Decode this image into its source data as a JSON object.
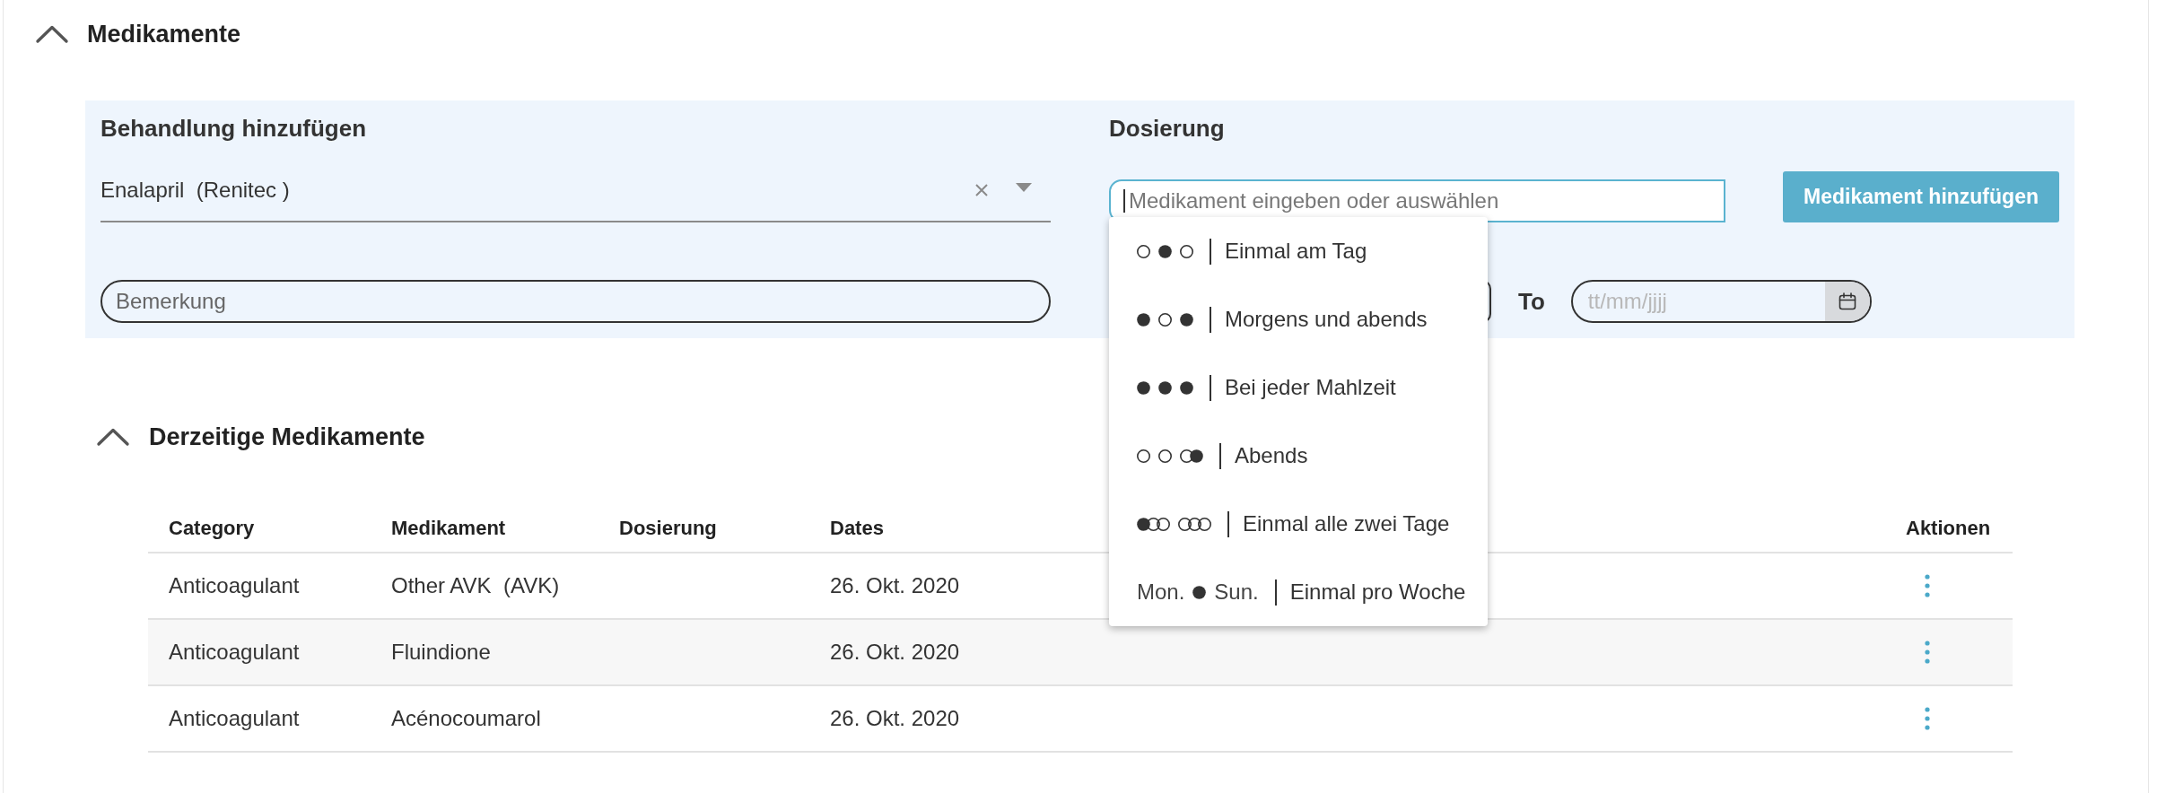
{
  "section": {
    "title": "Medikamente",
    "expanded": true
  },
  "add_treatment": {
    "title": "Behandlung hinzufügen",
    "medication_select": {
      "value": "Enalapril  (Renitec )"
    },
    "remark_field": {
      "placeholder": "Bemerkung"
    }
  },
  "dosage": {
    "title": "Dosierung",
    "dosage_field": {
      "placeholder": "Medikament eingeben oder auswählen",
      "focused": true
    },
    "add_button": {
      "label": "Medikament hinzufügen"
    },
    "to_label": "To",
    "to_date_field": {
      "placeholder": "tt/mm/jjjj"
    },
    "dropdown": {
      "open": true,
      "options": [
        {
          "symbols": [
            {
              "kind": "circles",
              "filled": [
                false
              ]
            },
            {
              "kind": "circles",
              "filled": [
                true
              ]
            },
            {
              "kind": "circles",
              "filled": [
                false
              ]
            }
          ],
          "label": "Einmal am Tag",
          "selected": false
        },
        {
          "symbols": [
            {
              "kind": "circles",
              "filled": [
                true
              ]
            },
            {
              "kind": "circles",
              "filled": [
                false
              ]
            },
            {
              "kind": "circles",
              "filled": [
                true
              ]
            }
          ],
          "label": "Morgens und abends",
          "selected": false
        },
        {
          "symbols": [
            {
              "kind": "circles",
              "filled": [
                true
              ]
            },
            {
              "kind": "circles",
              "filled": [
                true
              ]
            },
            {
              "kind": "circles",
              "filled": [
                true
              ]
            }
          ],
          "label": "Bei jeder Mahlzeit",
          "selected": false
        },
        {
          "symbols": [
            {
              "kind": "circles",
              "filled": [
                false
              ]
            },
            {
              "kind": "circles",
              "filled": [
                false
              ]
            },
            {
              "kind": "circles",
              "filled": [
                false,
                true
              ]
            }
          ],
          "label": "Abends",
          "selected": false
        },
        {
          "symbols": [
            {
              "kind": "circles",
              "filled": [
                true,
                false,
                false
              ]
            },
            {
              "kind": "circles",
              "filled": [
                false,
                false,
                false
              ]
            }
          ],
          "label": "Einmal alle zwei Tage",
          "selected": false
        },
        {
          "symbols": [
            {
              "kind": "text",
              "text": "Mon."
            },
            {
              "kind": "circles",
              "filled": [
                true
              ]
            },
            {
              "kind": "text",
              "text": "Sun."
            }
          ],
          "label": "Einmal pro Woche",
          "selected": false
        }
      ]
    }
  },
  "current_medications": {
    "title": "Derzeitige Medikamente",
    "expanded": true,
    "table": {
      "columns": [
        "Category",
        "Medikament",
        "Dosierung",
        "Dates",
        "Aktionen"
      ],
      "rows": [
        {
          "category": "Anticoagulant",
          "medication": "Other AVK  (AVK)",
          "dates": "26. Okt. 2020"
        },
        {
          "category": "Anticoagulant",
          "medication": "Fluindione",
          "dates": "26. Okt. 2020"
        },
        {
          "category": "Anticoagulant",
          "medication": "Acénocoumarol",
          "dates": "26. Okt. 2020"
        }
      ]
    }
  }
}
